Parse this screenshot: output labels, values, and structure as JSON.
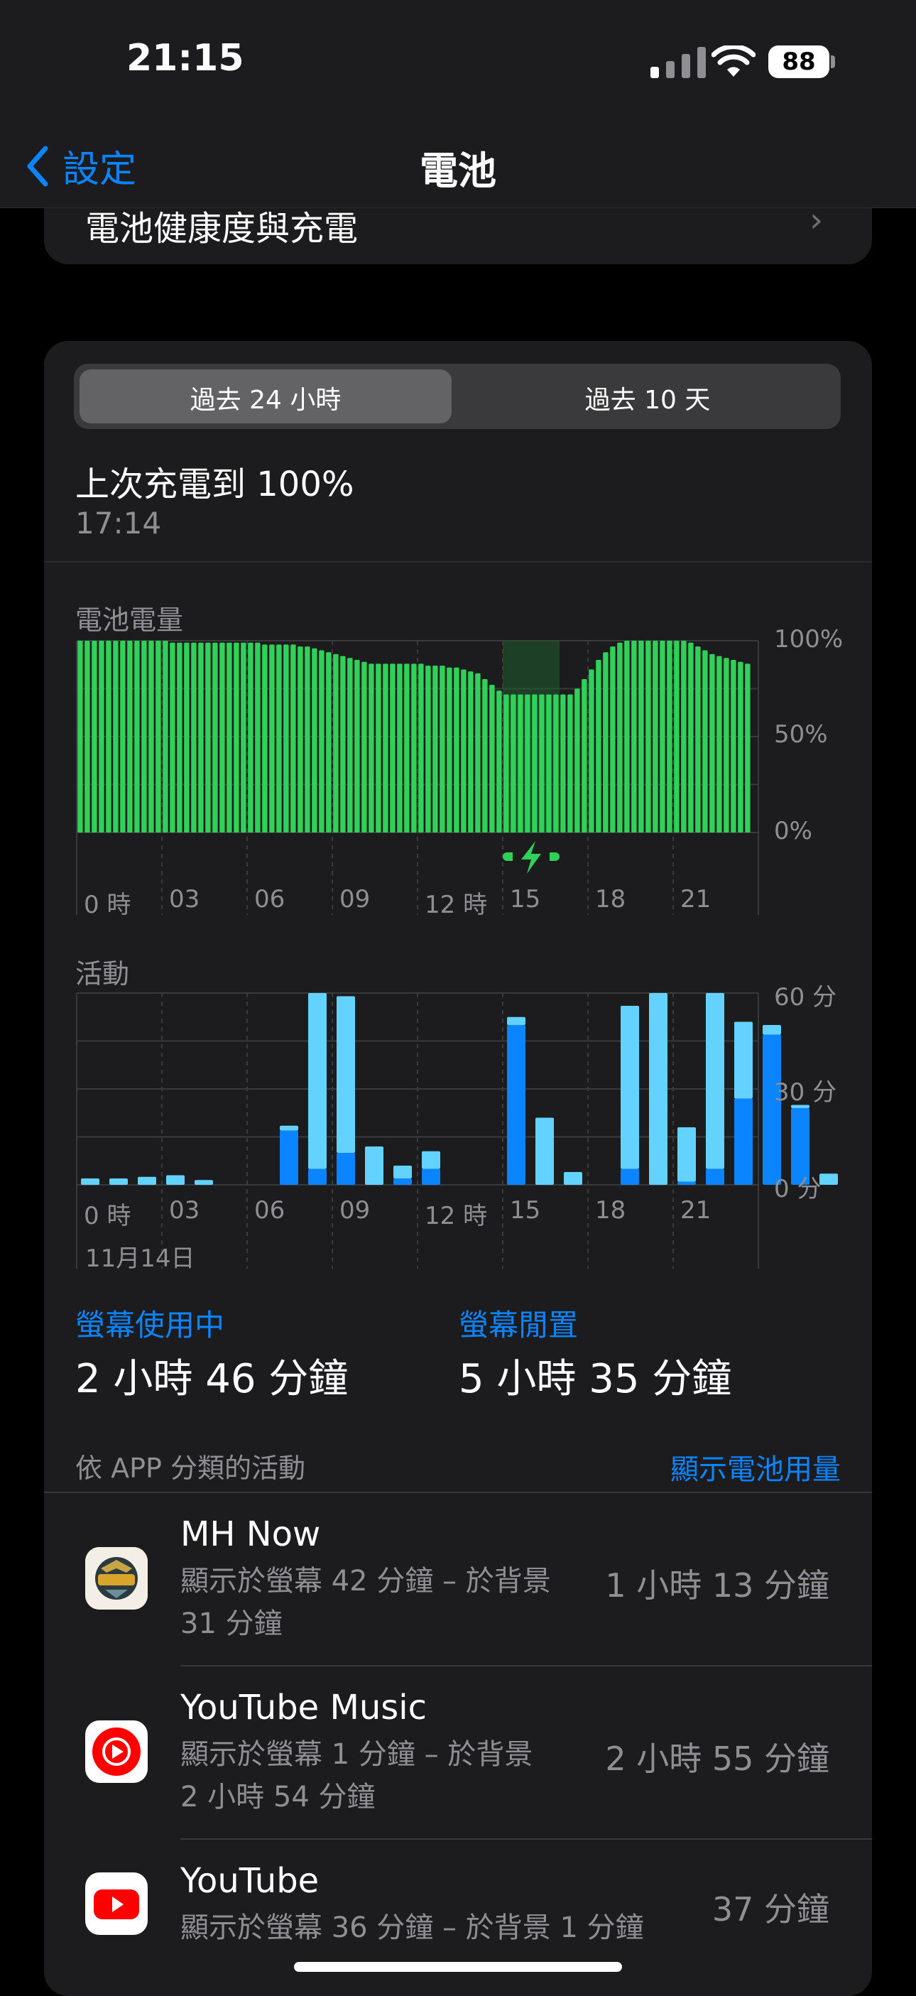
{
  "status": {
    "time": "21:15",
    "battery": "88"
  },
  "nav": {
    "back_label": "設定",
    "title": "電池"
  },
  "health_row": {
    "label": "電池健康度與充電"
  },
  "segment": {
    "options": [
      "過去 24 小時",
      "過去 10 天"
    ],
    "selected": 0
  },
  "last_charge": {
    "label": "上次充電到 100%",
    "time": "17:14"
  },
  "battery_chart": {
    "label": "電池電量",
    "y_ticks": [
      "100%",
      "50%",
      "0%"
    ],
    "x_ticks": [
      "0 時",
      "03",
      "06",
      "09",
      "12 時",
      "15",
      "18",
      "21"
    ]
  },
  "activity_chart": {
    "label": "活動",
    "y_ticks": [
      "60 分",
      "30 分",
      "0 分"
    ],
    "x_ticks": [
      "0 時",
      "03",
      "06",
      "09",
      "12 時",
      "15",
      "18",
      "21"
    ],
    "date": "11月14日"
  },
  "chart_data": [
    {
      "type": "bar",
      "title": "電池電量",
      "categories": [
        "0 時",
        "03",
        "06",
        "09",
        "12 時",
        "15",
        "18",
        "21"
      ],
      "ylim": [
        0,
        100
      ],
      "values": [
        100,
        100,
        100,
        100,
        100,
        100,
        100,
        100,
        100,
        100,
        100,
        100,
        100,
        99,
        99,
        99,
        99,
        99,
        99,
        99,
        99,
        99,
        99,
        99,
        99,
        99,
        98,
        98,
        98,
        98,
        98,
        97,
        97,
        96,
        95,
        94,
        93,
        92,
        91,
        90,
        89,
        88,
        88,
        88,
        88,
        88,
        88,
        88,
        88,
        87,
        87,
        87,
        86,
        86,
        85,
        84,
        83,
        80,
        77,
        74,
        72,
        72,
        72,
        72,
        72,
        72,
        72,
        72,
        72,
        72,
        75,
        80,
        85,
        90,
        94,
        97,
        99,
        100,
        100,
        100,
        100,
        100,
        100,
        100,
        100,
        100,
        99,
        97,
        95,
        93,
        92,
        91,
        90,
        89,
        88
      ],
      "charging_hours": [
        15,
        17
      ]
    },
    {
      "type": "bar",
      "title": "活動",
      "categories": [
        "0 時",
        "03",
        "06",
        "09",
        "12 時",
        "15",
        "18",
        "21"
      ],
      "ylim": [
        0,
        60
      ],
      "series": [
        {
          "name": "螢幕使用中",
          "values": [
            0,
            0,
            0,
            0,
            0,
            0,
            0,
            17,
            5,
            10,
            0,
            2,
            5,
            0,
            0,
            50,
            0,
            0,
            0,
            5,
            0,
            1,
            5,
            27,
            47,
            24,
            0,
            0
          ]
        },
        {
          "name": "螢幕閒置",
          "values": [
            2,
            2,
            2.5,
            3,
            1.5,
            0,
            0,
            1.5,
            55,
            49,
            12,
            4,
            5.5,
            0,
            0,
            2.5,
            21,
            4,
            0,
            51,
            60,
            17,
            55,
            24,
            3,
            1,
            3.5,
            0
          ]
        }
      ]
    }
  ],
  "screen_active": {
    "label": "螢幕使用中",
    "value": "2 小時 46 分鐘"
  },
  "screen_idle": {
    "label": "螢幕閒置",
    "value": "5 小時 35 分鐘"
  },
  "by_app": {
    "label": "依 APP 分類的活動",
    "action": "顯示電池用量"
  },
  "apps": [
    {
      "name": "MH Now",
      "sub1": "顯示於螢幕 42 分鐘 – 於背景",
      "sub2": "31 分鐘",
      "time": "1 小時 13 分鐘",
      "icon": "mh-now-icon"
    },
    {
      "name": "YouTube Music",
      "sub1": "顯示於螢幕 1 分鐘 – 於背景",
      "sub2": "2 小時 54 分鐘",
      "time": "2 小時 55 分鐘",
      "icon": "youtube-music-icon"
    },
    {
      "name": "YouTube",
      "sub1": "顯示於螢幕 36 分鐘 – 於背景 1 分鐘",
      "sub2": "",
      "time": "37 分鐘",
      "icon": "youtube-icon"
    }
  ],
  "colors": {
    "accent": "#0a84ff",
    "battery_green": "#30d158",
    "activity_dark": "#0a84ff",
    "activity_light": "#64d2ff"
  }
}
